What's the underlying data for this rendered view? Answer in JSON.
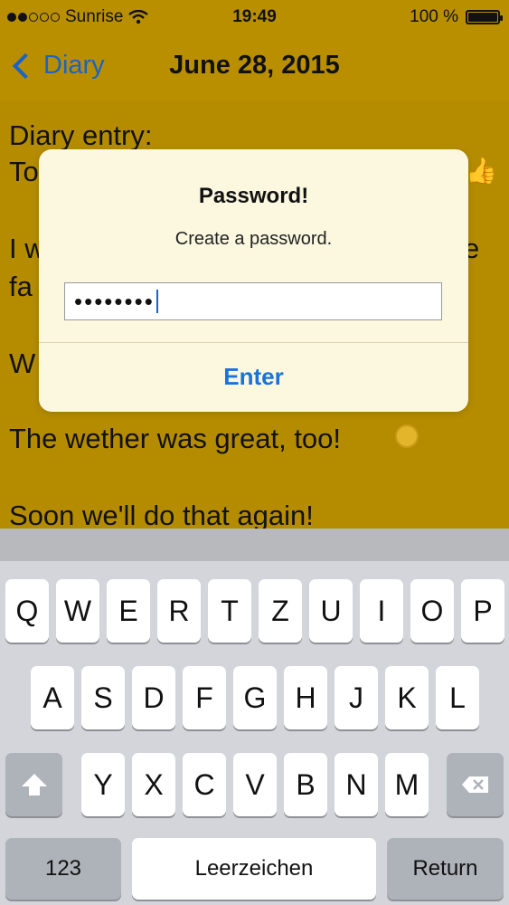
{
  "status_bar": {
    "carrier": "Sunrise",
    "time": "19:49",
    "battery": "100 %"
  },
  "nav": {
    "back_label": "Diary",
    "title": "June 28, 2015"
  },
  "content": {
    "lines": [
      "Diary entry:",
      "To",
      "I w",
      "e",
      "fa",
      "W",
      "The wether was great, too!",
      "Soon we'll do that again!"
    ]
  },
  "alert": {
    "title": "Password!",
    "message": "Create a password.",
    "password_value": "••••••••",
    "button": "Enter"
  },
  "keyboard": {
    "row1": [
      "Q",
      "W",
      "E",
      "R",
      "T",
      "Z",
      "U",
      "I",
      "O",
      "P"
    ],
    "row2": [
      "A",
      "S",
      "D",
      "F",
      "G",
      "H",
      "J",
      "K",
      "L"
    ],
    "row3": [
      "Y",
      "X",
      "C",
      "V",
      "B",
      "N",
      "M"
    ],
    "numbers_label": "123",
    "space_label": "Leerzeichen",
    "return_label": "Return"
  },
  "colors": {
    "background": "#b58c00",
    "accent": "#1a73d9",
    "alert_bg": "#fbf8df"
  }
}
